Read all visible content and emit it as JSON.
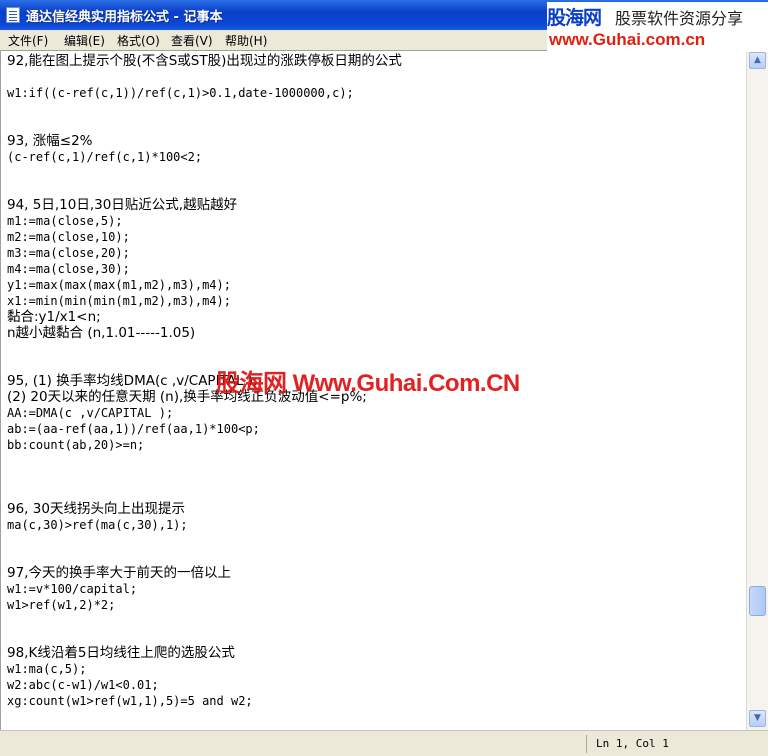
{
  "window": {
    "title": "通达信经典实用指标公式 - 记事本"
  },
  "menu": [
    "文件(F)",
    "编辑(E)",
    "格式(O)",
    "查看(V)",
    "帮助(H)"
  ],
  "logo": {
    "name": "股海网",
    "tagline": "股票软件资源分享",
    "url": "www.Guhai.com.cn"
  },
  "watermark": "股海网 Www.Guhai.Com.CN",
  "lines": [
    "92,能在图上提示个股(不含S或ST股)出现过的涨跌停板日期的公式",
    "",
    "w1:if((c-ref(c,1))/ref(c,1)>0.1,date-1000000,c);",
    "",
    "",
    "93, 涨幅≤2%",
    "(c-ref(c,1)/ref(c,1)*100<2;",
    "",
    "",
    "94, 5日,10日,30日贴近公式,越贴越好",
    "m1:=ma(close,5);",
    "m2:=ma(close,10);",
    "m3:=ma(close,20);",
    "m4:=ma(close,30);",
    "y1:=max(max(max(m1,m2),m3),m4);",
    "x1:=min(min(min(m1,m2),m3),m4);",
    "黏合:y1/x1<n;",
    "n越小越黏合 (n,1.01-----1.05)",
    "",
    "",
    "95, (1) 换手率均线DMA(c ,v/CAPITAL );",
    "(2) 20天以来的任意天期 (n),换手率均线正负波动值<=p%;",
    "AA:=DMA(c ,v/CAPITAL );",
    "ab:=(aa-ref(aa,1))/ref(aa,1)*100<p;",
    "bb:count(ab,20)>=n;",
    "",
    "",
    "",
    "96, 30天线拐头向上出现提示",
    "ma(c,30)>ref(ma(c,30),1);",
    "",
    "",
    "97,今天的换手率大于前天的一倍以上",
    "w1:=v*100/capital;",
    "w1>ref(w1,2)*2;",
    "",
    "",
    "98,K线沿着5日均线往上爬的选股公式",
    "w1:ma(c,5);",
    "w2:abc(c-w1)/w1<0.01;",
    "xg:count(w1>ref(w1,1),5)=5 and w2;"
  ],
  "status": {
    "position": "Ln 1, Col 1"
  }
}
